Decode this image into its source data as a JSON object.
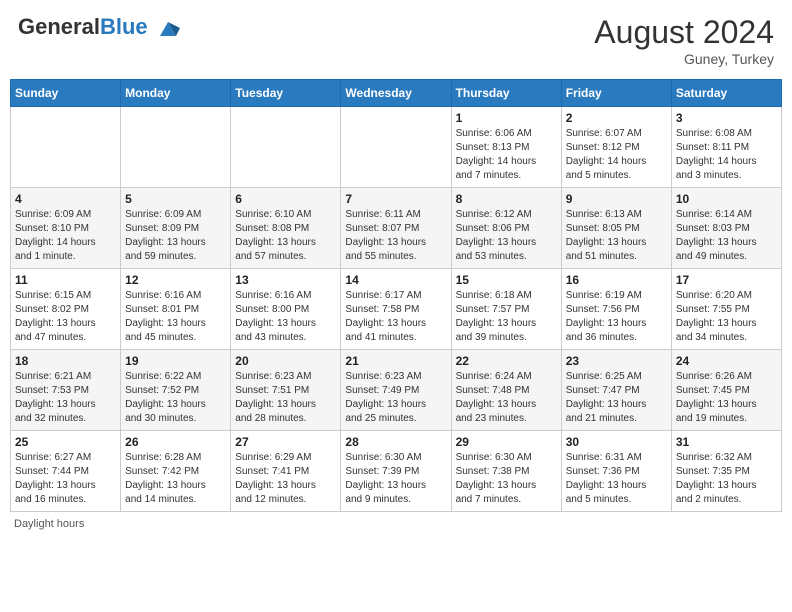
{
  "header": {
    "logo": {
      "general": "General",
      "blue": "Blue"
    },
    "title": "August 2024",
    "location": "Guney, Turkey"
  },
  "days_of_week": [
    "Sunday",
    "Monday",
    "Tuesday",
    "Wednesday",
    "Thursday",
    "Friday",
    "Saturday"
  ],
  "weeks": [
    [
      {
        "day": "",
        "info": ""
      },
      {
        "day": "",
        "info": ""
      },
      {
        "day": "",
        "info": ""
      },
      {
        "day": "",
        "info": ""
      },
      {
        "day": "1",
        "info": "Sunrise: 6:06 AM\nSunset: 8:13 PM\nDaylight: 14 hours\nand 7 minutes."
      },
      {
        "day": "2",
        "info": "Sunrise: 6:07 AM\nSunset: 8:12 PM\nDaylight: 14 hours\nand 5 minutes."
      },
      {
        "day": "3",
        "info": "Sunrise: 6:08 AM\nSunset: 8:11 PM\nDaylight: 14 hours\nand 3 minutes."
      }
    ],
    [
      {
        "day": "4",
        "info": "Sunrise: 6:09 AM\nSunset: 8:10 PM\nDaylight: 14 hours\nand 1 minute."
      },
      {
        "day": "5",
        "info": "Sunrise: 6:09 AM\nSunset: 8:09 PM\nDaylight: 13 hours\nand 59 minutes."
      },
      {
        "day": "6",
        "info": "Sunrise: 6:10 AM\nSunset: 8:08 PM\nDaylight: 13 hours\nand 57 minutes."
      },
      {
        "day": "7",
        "info": "Sunrise: 6:11 AM\nSunset: 8:07 PM\nDaylight: 13 hours\nand 55 minutes."
      },
      {
        "day": "8",
        "info": "Sunrise: 6:12 AM\nSunset: 8:06 PM\nDaylight: 13 hours\nand 53 minutes."
      },
      {
        "day": "9",
        "info": "Sunrise: 6:13 AM\nSunset: 8:05 PM\nDaylight: 13 hours\nand 51 minutes."
      },
      {
        "day": "10",
        "info": "Sunrise: 6:14 AM\nSunset: 8:03 PM\nDaylight: 13 hours\nand 49 minutes."
      }
    ],
    [
      {
        "day": "11",
        "info": "Sunrise: 6:15 AM\nSunset: 8:02 PM\nDaylight: 13 hours\nand 47 minutes."
      },
      {
        "day": "12",
        "info": "Sunrise: 6:16 AM\nSunset: 8:01 PM\nDaylight: 13 hours\nand 45 minutes."
      },
      {
        "day": "13",
        "info": "Sunrise: 6:16 AM\nSunset: 8:00 PM\nDaylight: 13 hours\nand 43 minutes."
      },
      {
        "day": "14",
        "info": "Sunrise: 6:17 AM\nSunset: 7:58 PM\nDaylight: 13 hours\nand 41 minutes."
      },
      {
        "day": "15",
        "info": "Sunrise: 6:18 AM\nSunset: 7:57 PM\nDaylight: 13 hours\nand 39 minutes."
      },
      {
        "day": "16",
        "info": "Sunrise: 6:19 AM\nSunset: 7:56 PM\nDaylight: 13 hours\nand 36 minutes."
      },
      {
        "day": "17",
        "info": "Sunrise: 6:20 AM\nSunset: 7:55 PM\nDaylight: 13 hours\nand 34 minutes."
      }
    ],
    [
      {
        "day": "18",
        "info": "Sunrise: 6:21 AM\nSunset: 7:53 PM\nDaylight: 13 hours\nand 32 minutes."
      },
      {
        "day": "19",
        "info": "Sunrise: 6:22 AM\nSunset: 7:52 PM\nDaylight: 13 hours\nand 30 minutes."
      },
      {
        "day": "20",
        "info": "Sunrise: 6:23 AM\nSunset: 7:51 PM\nDaylight: 13 hours\nand 28 minutes."
      },
      {
        "day": "21",
        "info": "Sunrise: 6:23 AM\nSunset: 7:49 PM\nDaylight: 13 hours\nand 25 minutes."
      },
      {
        "day": "22",
        "info": "Sunrise: 6:24 AM\nSunset: 7:48 PM\nDaylight: 13 hours\nand 23 minutes."
      },
      {
        "day": "23",
        "info": "Sunrise: 6:25 AM\nSunset: 7:47 PM\nDaylight: 13 hours\nand 21 minutes."
      },
      {
        "day": "24",
        "info": "Sunrise: 6:26 AM\nSunset: 7:45 PM\nDaylight: 13 hours\nand 19 minutes."
      }
    ],
    [
      {
        "day": "25",
        "info": "Sunrise: 6:27 AM\nSunset: 7:44 PM\nDaylight: 13 hours\nand 16 minutes."
      },
      {
        "day": "26",
        "info": "Sunrise: 6:28 AM\nSunset: 7:42 PM\nDaylight: 13 hours\nand 14 minutes."
      },
      {
        "day": "27",
        "info": "Sunrise: 6:29 AM\nSunset: 7:41 PM\nDaylight: 13 hours\nand 12 minutes."
      },
      {
        "day": "28",
        "info": "Sunrise: 6:30 AM\nSunset: 7:39 PM\nDaylight: 13 hours\nand 9 minutes."
      },
      {
        "day": "29",
        "info": "Sunrise: 6:30 AM\nSunset: 7:38 PM\nDaylight: 13 hours\nand 7 minutes."
      },
      {
        "day": "30",
        "info": "Sunrise: 6:31 AM\nSunset: 7:36 PM\nDaylight: 13 hours\nand 5 minutes."
      },
      {
        "day": "31",
        "info": "Sunrise: 6:32 AM\nSunset: 7:35 PM\nDaylight: 13 hours\nand 2 minutes."
      }
    ]
  ],
  "footer": "Daylight hours"
}
